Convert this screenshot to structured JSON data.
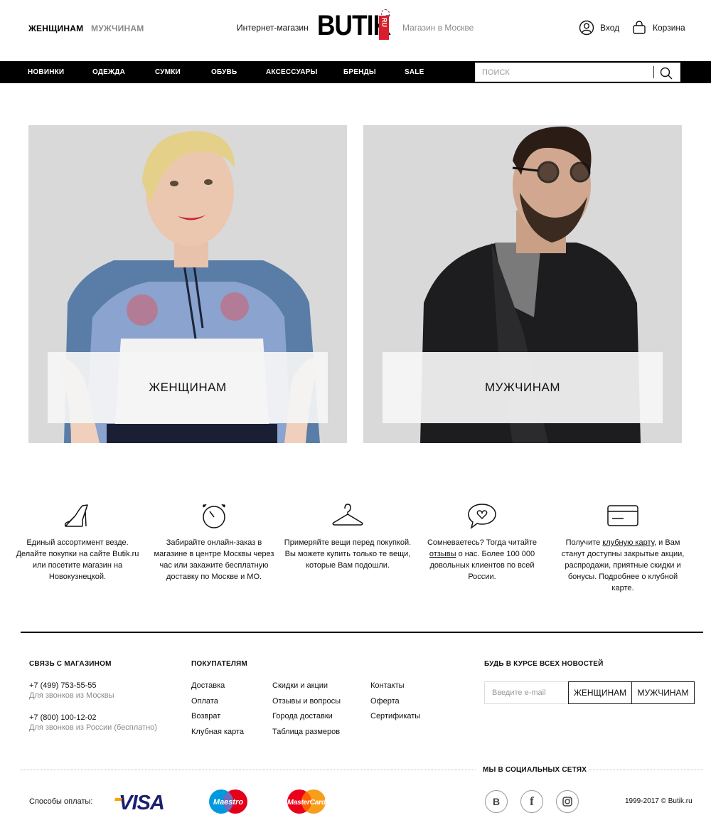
{
  "header": {
    "gender_women": "ЖЕНЩИНАМ",
    "gender_men": "МУЖЧИНАМ",
    "shop_left": "Интернет-магазин",
    "logo_text": "BUTIK",
    "logo_tag": "RU",
    "shop_right": "Магазин в Москве",
    "login": "Вход",
    "cart": "Корзина"
  },
  "nav": {
    "items": [
      "НОВИНКИ",
      "ОДЕЖДА",
      "СУМКИ",
      "ОБУВЬ",
      "АКСЕССУАРЫ",
      "БРЕНДЫ",
      "SALE"
    ],
    "search_placeholder": "поиск"
  },
  "hero": {
    "women_label": "ЖЕНЩИНАМ",
    "men_label": "МУЖЧИНАМ"
  },
  "features": [
    {
      "icon": "shoe-icon",
      "text": "Единый ассортимент везде. Делайте покупки на сайте Butik.ru или посетите магазин на Новокузнецкой."
    },
    {
      "icon": "alarm-clock-icon",
      "text": "Забирайте онлайн-заказ в магазине в центре Москвы через час или закажите бесплатную доставку по Москве и МО."
    },
    {
      "icon": "hanger-icon",
      "text": "Примеряйте вещи перед покупкой. Вы можете купить только те вещи, которые Вам подошли."
    },
    {
      "icon": "heart-chat-icon",
      "text_before": "Сомневаетесь? Тогда читайте",
      "link": "отзывы",
      "text_after": "о нас. Более 100 000 довольных клиентов по всей России."
    },
    {
      "icon": "card-icon",
      "text_before": "Получите",
      "link": "клубную карту",
      "text_after": ", и Вам станут доступны закрытые акции, распродажи, приятные скидки и бонусы. Подробнее о клубной карте."
    }
  ],
  "footer": {
    "contact_title": "СВЯЗЬ С МАГАЗИНОМ",
    "phone1": "+7 (499) 753-55-55",
    "phone1_note": "Для звонков из Москвы",
    "phone2": "+7 (800) 100-12-02",
    "phone2_note": "Для звонков из России (бесплатно)",
    "buyers_title": "ПОКУПАТЕЛЯМ",
    "col1": [
      "Доставка",
      "Оплата",
      "Возврат",
      "Клубная карта"
    ],
    "col2": [
      "Скидки и акции",
      "Отзывы и вопросы",
      "Города доставки",
      "Таблица размеров"
    ],
    "col3": [
      "Контакты",
      "Оферта",
      "Сертификаты"
    ],
    "news_title": "БУДЬ В КУРСЕ ВСЕХ НОВОСТЕЙ",
    "email_placeholder": "Введите e-mail",
    "sub_women": "ЖЕНЩИНАМ",
    "sub_men": "МУЖЧИНАМ",
    "social_title": "МЫ В СОЦИАЛЬНЫХ СЕТЯХ",
    "payment_label": "Способы оплаты:",
    "visa": "VISA",
    "maestro": "Maestro",
    "mastercard": "MasterCard",
    "vk": "B",
    "fb": "f",
    "copyright": "1999-2017 © Butik.ru"
  },
  "colors": {
    "brand_red": "#d81e2c",
    "nav_bg": "#000000",
    "visa_blue": "#1a1f71",
    "maestro_blue": "#0099df",
    "maestro_red": "#e4001b",
    "mc_red": "#eb001b",
    "mc_orange": "#f79e1b"
  }
}
